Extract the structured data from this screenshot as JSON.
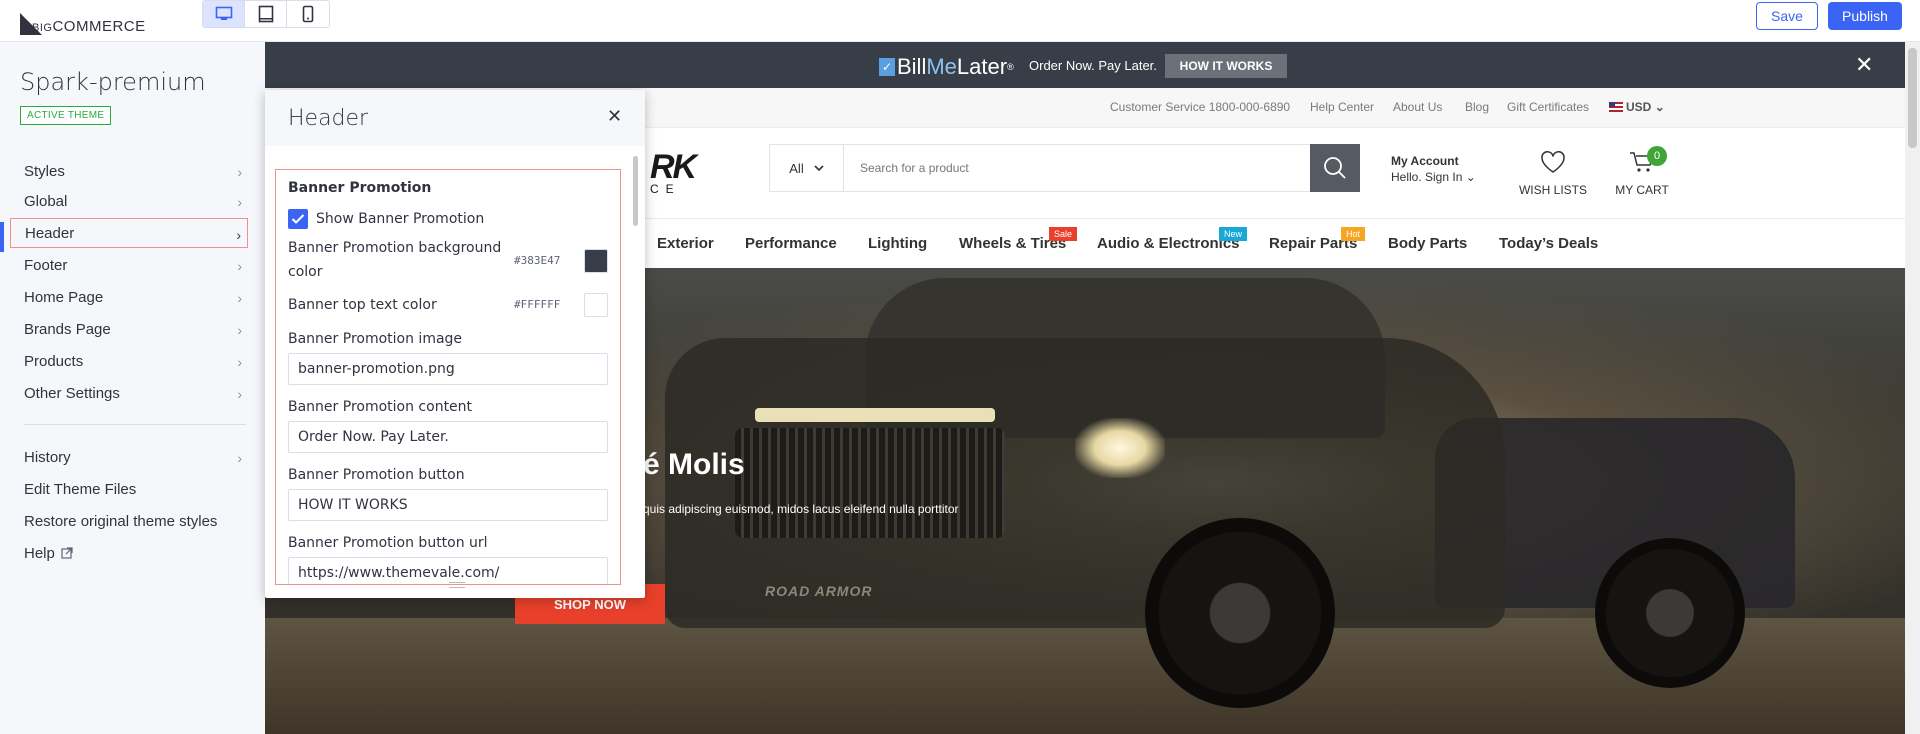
{
  "toolbar": {
    "brand": "COMMERCE",
    "brand_prefix": "BIG",
    "devices": [
      "desktop-icon",
      "tablet-icon",
      "mobile-icon"
    ],
    "active_device": "desktop",
    "save_label": "Save",
    "publish_label": "Publish",
    "accent": "#3c64f4"
  },
  "sidebar": {
    "theme_name": "Spark-premium",
    "active_badge": "ACTIVE THEME",
    "items": [
      {
        "label": "Styles",
        "chevron": true
      },
      {
        "label": "Global",
        "chevron": true
      },
      {
        "label": "Header",
        "chevron": true,
        "selected": true
      },
      {
        "label": "Footer",
        "chevron": true
      },
      {
        "label": "Home Page",
        "chevron": true
      },
      {
        "label": "Brands Page",
        "chevron": true
      },
      {
        "label": "Products",
        "chevron": true
      },
      {
        "label": "Other Settings",
        "chevron": true
      }
    ],
    "secondary": [
      {
        "label": "History",
        "chevron": true
      },
      {
        "label": "Edit Theme Files"
      },
      {
        "label": "Restore original theme styles"
      },
      {
        "label": "Help"
      }
    ]
  },
  "panel": {
    "title": "Header",
    "section": "Banner Promotion",
    "show_banner_label": "Show Banner Promotion",
    "show_banner_checked": true,
    "bg_color_label_line1": "Banner Promotion background",
    "bg_color_label_line2": "color",
    "bg_color_hex": "#383E47",
    "text_color_label": "Banner top text color",
    "text_color_hex": "#FFFFFF",
    "image_label": "Banner Promotion image",
    "image_value": "banner-promotion.png",
    "content_label": "Banner Promotion content",
    "content_value": "Order Now. Pay Later.",
    "button_label": "Banner Promotion button",
    "button_value": "HOW IT WORKS",
    "button_url_label": "Banner Promotion button url",
    "button_url_value": "https://www.themevale.com/"
  },
  "preview": {
    "promo": {
      "logo_bill": "Bill",
      "logo_me": "Me",
      "logo_later": "Later",
      "logo_mark": "®",
      "text": "Order Now. Pay Later.",
      "button": "HOW IT WORKS",
      "close": "✕"
    },
    "top_links": {
      "service": "Customer Service 1800-000-6890",
      "help": "Help Center",
      "about": "About Us",
      "blog": "Blog",
      "gift": "Gift Certificates",
      "currency": "USD"
    },
    "logo_fragment": "RK",
    "logo_sub": "CE",
    "search": {
      "category": "All",
      "placeholder": "Search for a product"
    },
    "account": {
      "title": "My Account",
      "subtitle": "Hello. Sign In"
    },
    "wishlist": "WISH LISTS",
    "cart": {
      "label": "MY CART",
      "count": "0"
    },
    "categories": [
      {
        "label": "Exterior"
      },
      {
        "label": "Performance"
      },
      {
        "label": "Lighting"
      },
      {
        "label": "Wheels & Tires",
        "badge": "Sale",
        "badge_color": "#e8402a"
      },
      {
        "label": "Audio & Electronics",
        "badge": "New",
        "badge_color": "#17a8d8"
      },
      {
        "label": "Repair Parts",
        "badge": "Hot",
        "badge_color": "#f5a623"
      },
      {
        "label": "Body Parts"
      },
      {
        "label": "Today’s Deals"
      }
    ],
    "hero": {
      "title": "é Molis",
      "subtitle": "quis adipiscing euismod, midos lacus eleifend nulla porttitor",
      "button": "SHOP NOW"
    },
    "truck_badge": "ROAD ARMOR"
  }
}
